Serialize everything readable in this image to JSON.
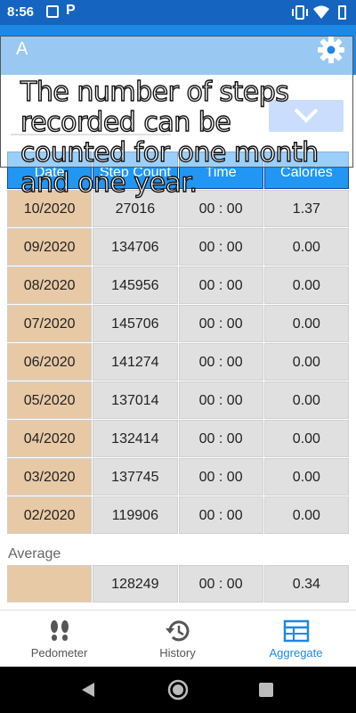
{
  "status_bar": {
    "time": "8:56",
    "p_icon": "P"
  },
  "app_bar": {
    "title": "A"
  },
  "tooltip": {
    "text": "The number of steps recorded can be counted for one month and one year."
  },
  "table": {
    "headers": [
      "Date",
      "Step Count",
      "Time",
      "Calories"
    ],
    "rows": [
      [
        "10/2020",
        "27016",
        "00 : 00",
        "1.37"
      ],
      [
        "09/2020",
        "134706",
        "00 : 00",
        "0.00"
      ],
      [
        "08/2020",
        "145956",
        "00 : 00",
        "0.00"
      ],
      [
        "07/2020",
        "145706",
        "00 : 00",
        "0.00"
      ],
      [
        "06/2020",
        "141274",
        "00 : 00",
        "0.00"
      ],
      [
        "05/2020",
        "137014",
        "00 : 00",
        "0.00"
      ],
      [
        "04/2020",
        "132414",
        "00 : 00",
        "0.00"
      ],
      [
        "03/2020",
        "137745",
        "00 : 00",
        "0.00"
      ],
      [
        "02/2020",
        "119906",
        "00 : 00",
        "0.00"
      ]
    ]
  },
  "average": {
    "label": "Average",
    "values": [
      "",
      "128249",
      "00 : 00",
      "0.34"
    ]
  },
  "bottom_nav": {
    "items": [
      {
        "label": "Pedometer",
        "icon": "footprints-icon"
      },
      {
        "label": "History",
        "icon": "history-icon"
      },
      {
        "label": "Aggregate",
        "icon": "table-icon"
      }
    ],
    "active": "Aggregate"
  },
  "colors": {
    "status_bar": "#1565c0",
    "app_bar": "#1e88e5",
    "header": "#2196f3",
    "date_cell": "#e8c9a6",
    "data_cell": "#e0e0e0",
    "accent": "#1e88e5"
  }
}
